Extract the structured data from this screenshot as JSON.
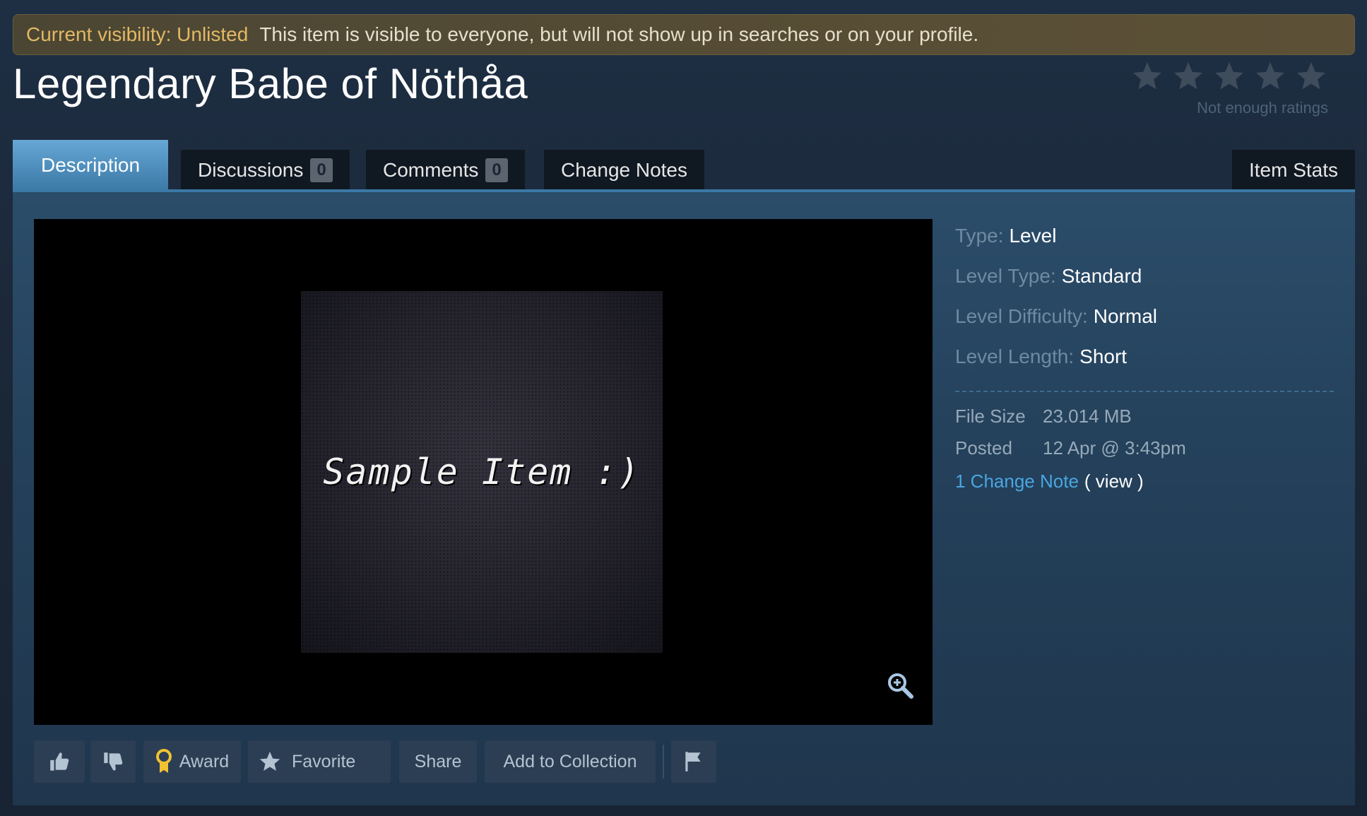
{
  "visibility": {
    "label": "Current visibility: Unlisted",
    "text": "This item is visible to everyone, but will not show up in searches or on your profile."
  },
  "item": {
    "title": "Legendary Babe of Nöthåa"
  },
  "rating": {
    "stars_filled": 0,
    "stars_total": 5,
    "text": "Not enough ratings"
  },
  "tabs": {
    "description": "Description",
    "discussions": "Discussions",
    "discussions_count": "0",
    "comments": "Comments",
    "comments_count": "0",
    "change_notes": "Change Notes",
    "item_stats": "Item Stats"
  },
  "preview": {
    "caption": "Sample Item :)"
  },
  "stats": {
    "type_label": "Type:",
    "type_value": "Level",
    "level_type_label": "Level Type:",
    "level_type_value": "Standard",
    "difficulty_label": "Level Difficulty:",
    "difficulty_value": "Normal",
    "length_label": "Level Length:",
    "length_value": "Short"
  },
  "details": {
    "file_size_label": "File Size",
    "file_size_value": "23.014 MB",
    "posted_label": "Posted",
    "posted_value": "12 Apr @ 3:43pm",
    "change_note_link": "1 Change Note",
    "view_text": "( view )"
  },
  "actions": {
    "award": "Award",
    "favorite": "Favorite",
    "share": "Share",
    "add_to_collection": "Add to Collection"
  },
  "colors": {
    "background": "#1b2838",
    "banner_label": "#e3b864",
    "active_tab": "#66a7d6",
    "link": "#4aa6e0",
    "award_icon": "#f1c232"
  }
}
